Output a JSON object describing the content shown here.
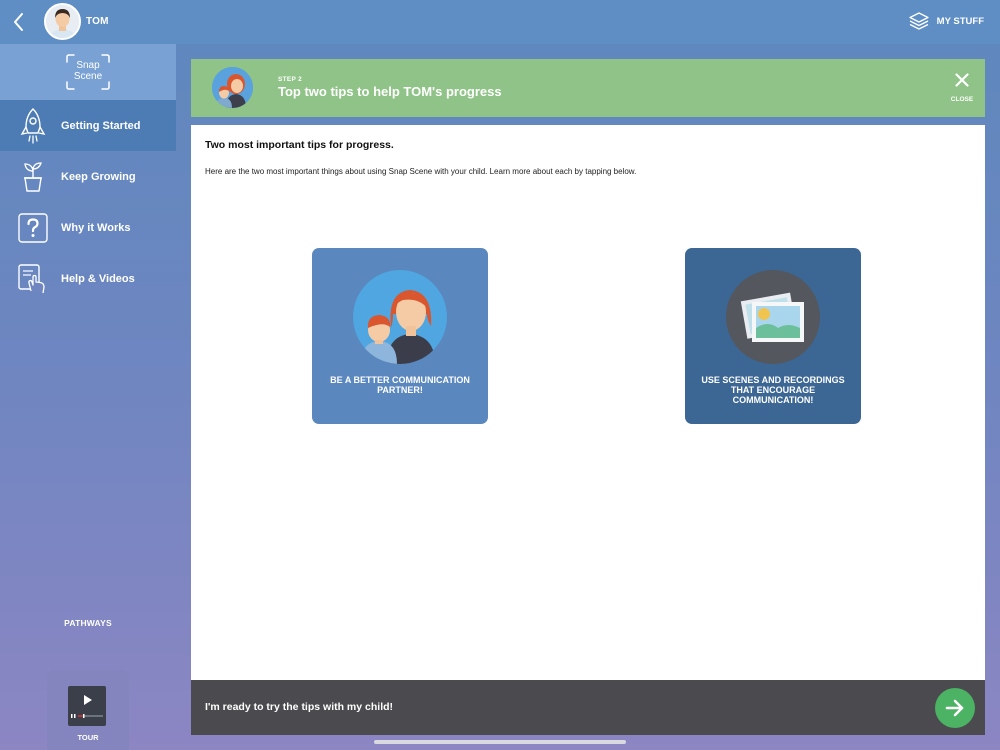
{
  "topbar": {
    "user_name": "TOM",
    "mystuff_label": "MY STUFF"
  },
  "sidebar": {
    "logo_line1": "Snap",
    "logo_line2": "Scene",
    "items": [
      {
        "label": "Getting Started",
        "icon": "rocket-icon",
        "active": true
      },
      {
        "label": "Keep Growing",
        "icon": "plant-icon",
        "active": false
      },
      {
        "label": "Why it Works",
        "icon": "question-icon",
        "active": false
      },
      {
        "label": "Help & Videos",
        "icon": "tablet-touch-icon",
        "active": false
      }
    ],
    "pathways_label": "PATHWAYS",
    "tour_label": "TOUR"
  },
  "banner": {
    "step_label": "STEP 2",
    "title": "Top two tips to help TOM's progress",
    "close_label": "CLOSE"
  },
  "content": {
    "title": "Two most important tips for progress.",
    "description": "Here are the two most important things about using Snap Scene with your child. Learn more about each by tapping below.",
    "tips": [
      {
        "label": "BE A BETTER COMMUNICATION PARTNER!"
      },
      {
        "label": "USE SCENES AND RECORDINGS THAT ENCOURAGE COMMUNICATION!"
      }
    ]
  },
  "footer": {
    "text": "I'm ready to try the tips with my child!"
  },
  "colors": {
    "topbar": "#5e8ec4",
    "banner": "#8fc387",
    "card_one": "#5b87bf",
    "card_two": "#3c6795",
    "next_button": "#4bb363",
    "footer": "#4b4b4f"
  }
}
